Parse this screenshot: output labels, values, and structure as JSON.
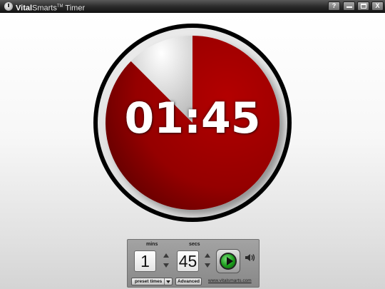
{
  "window": {
    "title_brand_bold": "Vital",
    "title_brand_rest": "Smarts",
    "title_tm": "TM",
    "title_word": "Timer",
    "help_label": "?",
    "close_label": "X"
  },
  "timer": {
    "display": "01:45",
    "elapsed_fraction": 0.125,
    "colors": {
      "face": "#990000",
      "elapsed": "#d8d8d8",
      "ring": "#000000"
    }
  },
  "controls": {
    "mins_label": "mins",
    "secs_label": "secs",
    "mins_value": "1",
    "secs_value": "45",
    "preset_label": "preset times",
    "advanced_label": "Advanced",
    "link_text": "www.vitalsmarts.com",
    "play_icon": "play-icon",
    "sound_icon": "speaker-icon"
  }
}
